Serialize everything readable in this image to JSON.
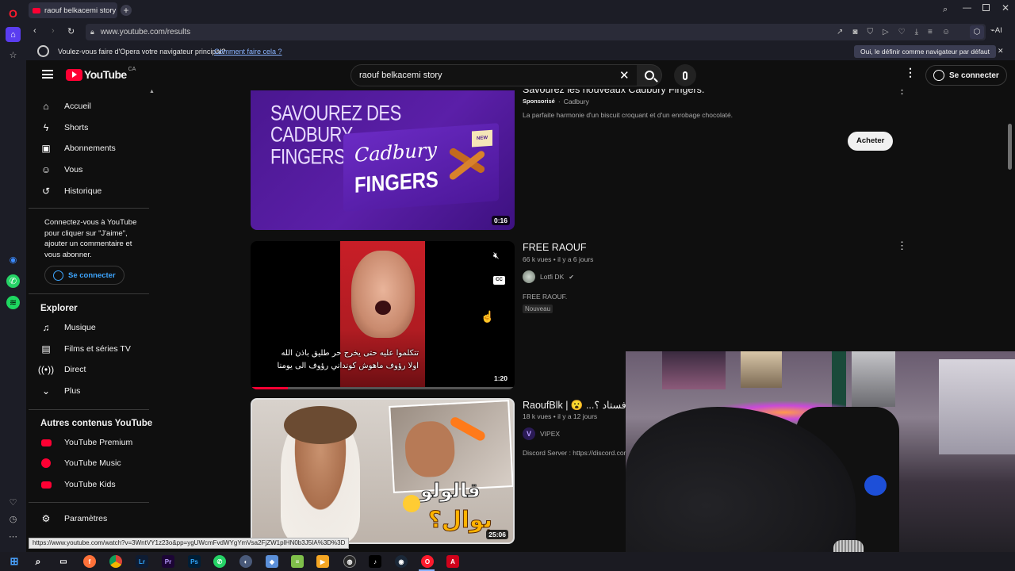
{
  "browser": {
    "tab_title": "raouf belkacemi story - Yo",
    "url": "www.youtube.com/results",
    "ai_label": "AI",
    "infobar": {
      "message": "Voulez-vous faire d'Opera votre navigateur principal?",
      "link": "Comment faire cela ?",
      "button": "Oui, le définir comme navigateur par défaut"
    },
    "status_url": "https://www.youtube.com/watch?v=3WntVY1z23o&pp=ygUWcmFvdWYgYmVsa2FjZW1pIHN0b3J5IA%3D%3D"
  },
  "youtube": {
    "logo_text": "YouTube",
    "country": "CA",
    "search_value": "raouf belkacemi story",
    "sign_in": "Se connecter"
  },
  "sidebar": {
    "main": [
      {
        "label": "Accueil",
        "icon": "home-icon"
      },
      {
        "label": "Shorts",
        "icon": "shorts-icon"
      },
      {
        "label": "Abonnements",
        "icon": "subscriptions-icon"
      },
      {
        "label": "Vous",
        "icon": "you-icon"
      },
      {
        "label": "Historique",
        "icon": "history-icon"
      }
    ],
    "signin_prompt": "Connectez-vous à YouTube pour cliquer sur \"J'aime\", ajouter un commentaire et vous abonner.",
    "signin_button": "Se connecter",
    "explore_title": "Explorer",
    "explore": [
      {
        "label": "Musique",
        "icon": "music-icon"
      },
      {
        "label": "Films et séries TV",
        "icon": "movies-icon"
      },
      {
        "label": "Direct",
        "icon": "live-icon"
      },
      {
        "label": "Plus",
        "icon": "chevron-down-icon"
      }
    ],
    "more_title": "Autres contenus YouTube",
    "more": [
      {
        "label": "YouTube Premium"
      },
      {
        "label": "YouTube Music"
      },
      {
        "label": "YouTube Kids"
      }
    ],
    "settings": "Paramètres"
  },
  "results": {
    "ad": {
      "title": "Savourez les nouveaux Cadbury Fingers.",
      "sponsored": "Sponsorisé",
      "advertiser": "Cadbury",
      "description": "La parfaite harmonie d'un biscuit croquant et d'un enrobage chocolaté.",
      "cta": "Acheter",
      "thumb_line1": "SAVOUREZ DES",
      "thumb_line2": "CADBURY",
      "thumb_line3": "FINGERS",
      "pack_brand": "Cadbury",
      "pack_name": "FINGERS",
      "pack_badge": "NEW",
      "duration": "0:16"
    },
    "video1": {
      "title": "FREE RAOUF",
      "meta": "66 k vues • il y a 6 jours",
      "channel": "Lotfi DK",
      "description": "FREE RAOUF.",
      "badge": "Nouveau",
      "duration": "1:20",
      "cc": "CC",
      "subtitle_line1": "تتكلموا عليه حتى يخرج حر طليق باذن الله",
      "subtitle_line2": "اولا رؤوف ماهوش كونداني رؤوف الى يومنا",
      "progress": 0.14
    },
    "video2": {
      "title": "RaoufBlk | 😮 ...بال فستاد ؟",
      "meta": "18 k vues • il y a 12 jours",
      "channel": "VIPEX",
      "description": "Discord Server : https://discord.com",
      "thumb_text1": "قالولو",
      "thumb_text2": "بوال؟",
      "duration": "25:06"
    }
  },
  "colors": {
    "yt_red": "#ff0033",
    "link_blue": "#3ea6ff",
    "purple": "#5b1fa8"
  }
}
